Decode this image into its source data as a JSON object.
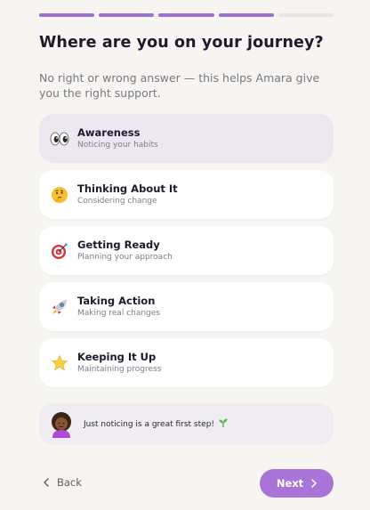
{
  "progress": {
    "total_steps": 5,
    "completed_steps": 4,
    "accent_color": "#9c6fd6"
  },
  "header": {
    "title": "Where are you on your journey?",
    "subtitle": "No right or wrong answer — this helps Amara give you the right support."
  },
  "options": [
    {
      "title": "Awareness",
      "subtitle": "Noticing your habits",
      "icon": "eyes-icon",
      "selected": true
    },
    {
      "title": "Thinking About It",
      "subtitle": "Considering change",
      "icon": "thinking-face-icon",
      "selected": false
    },
    {
      "title": "Getting Ready",
      "subtitle": "Planning your approach",
      "icon": "target-icon",
      "selected": false
    },
    {
      "title": "Taking Action",
      "subtitle": "Making real changes",
      "icon": "rocket-icon",
      "selected": false
    },
    {
      "title": "Keeping It Up",
      "subtitle": "Maintaining progress",
      "icon": "star-icon",
      "selected": false
    }
  ],
  "tip": {
    "avatar": "amara-avatar",
    "text": "Just noticing is a great first step!",
    "icon": "seedling-icon"
  },
  "footer": {
    "back_label": "Back",
    "next_label": "Next",
    "next_color": "#a874d8"
  }
}
